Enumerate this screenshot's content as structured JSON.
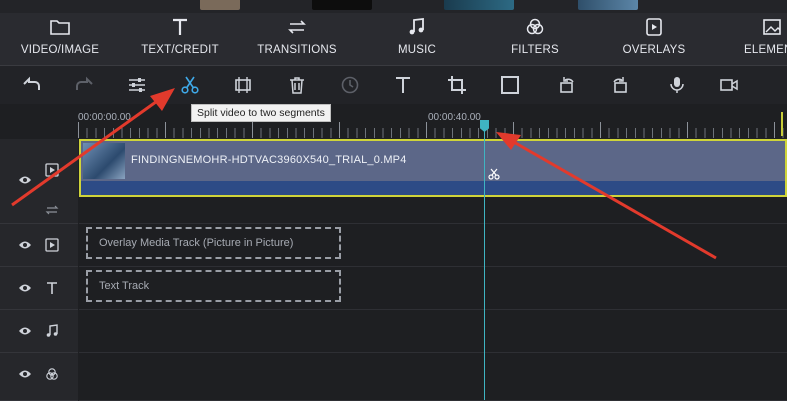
{
  "tabs": [
    {
      "label": "VIDEO/IMAGE",
      "icon": "folder-icon"
    },
    {
      "label": "TEXT/CREDIT",
      "icon": "text-icon"
    },
    {
      "label": "TRANSITIONS",
      "icon": "transitions-icon"
    },
    {
      "label": "MUSIC",
      "icon": "music-note-icon"
    },
    {
      "label": "FILTERS",
      "icon": "filters-icon"
    },
    {
      "label": "OVERLAYS",
      "icon": "overlays-icon"
    },
    {
      "label": "ELEMEN",
      "icon": "elements-icon"
    }
  ],
  "toolbar": {
    "tools": [
      "undo-icon",
      "redo-icon",
      "adjust-icon",
      "scissors-icon",
      "trim-icon",
      "trash-icon",
      "duration-icon",
      "text-icon",
      "crop-icon",
      "fullscreen-icon",
      "rotate-left-icon",
      "rotate-right-icon",
      "microphone-icon",
      "record-camera-icon"
    ],
    "tooltip": "Split video to two segments"
  },
  "ruler": {
    "start_time": "00:00:00.00",
    "mid_time": "00:00:40.00"
  },
  "tracks": {
    "video_clip_name": "FINDINGNEMOHR-HDTVAC3960X540_TRIAL_0.MP4",
    "overlay_placeholder": "Overlay Media Track (Picture in Picture)",
    "text_placeholder": "Text Track"
  },
  "colors": {
    "accent_playhead": "#3fb4c2",
    "clip_border": "#cfd43a",
    "annotation_arrow": "#e23a2c"
  }
}
